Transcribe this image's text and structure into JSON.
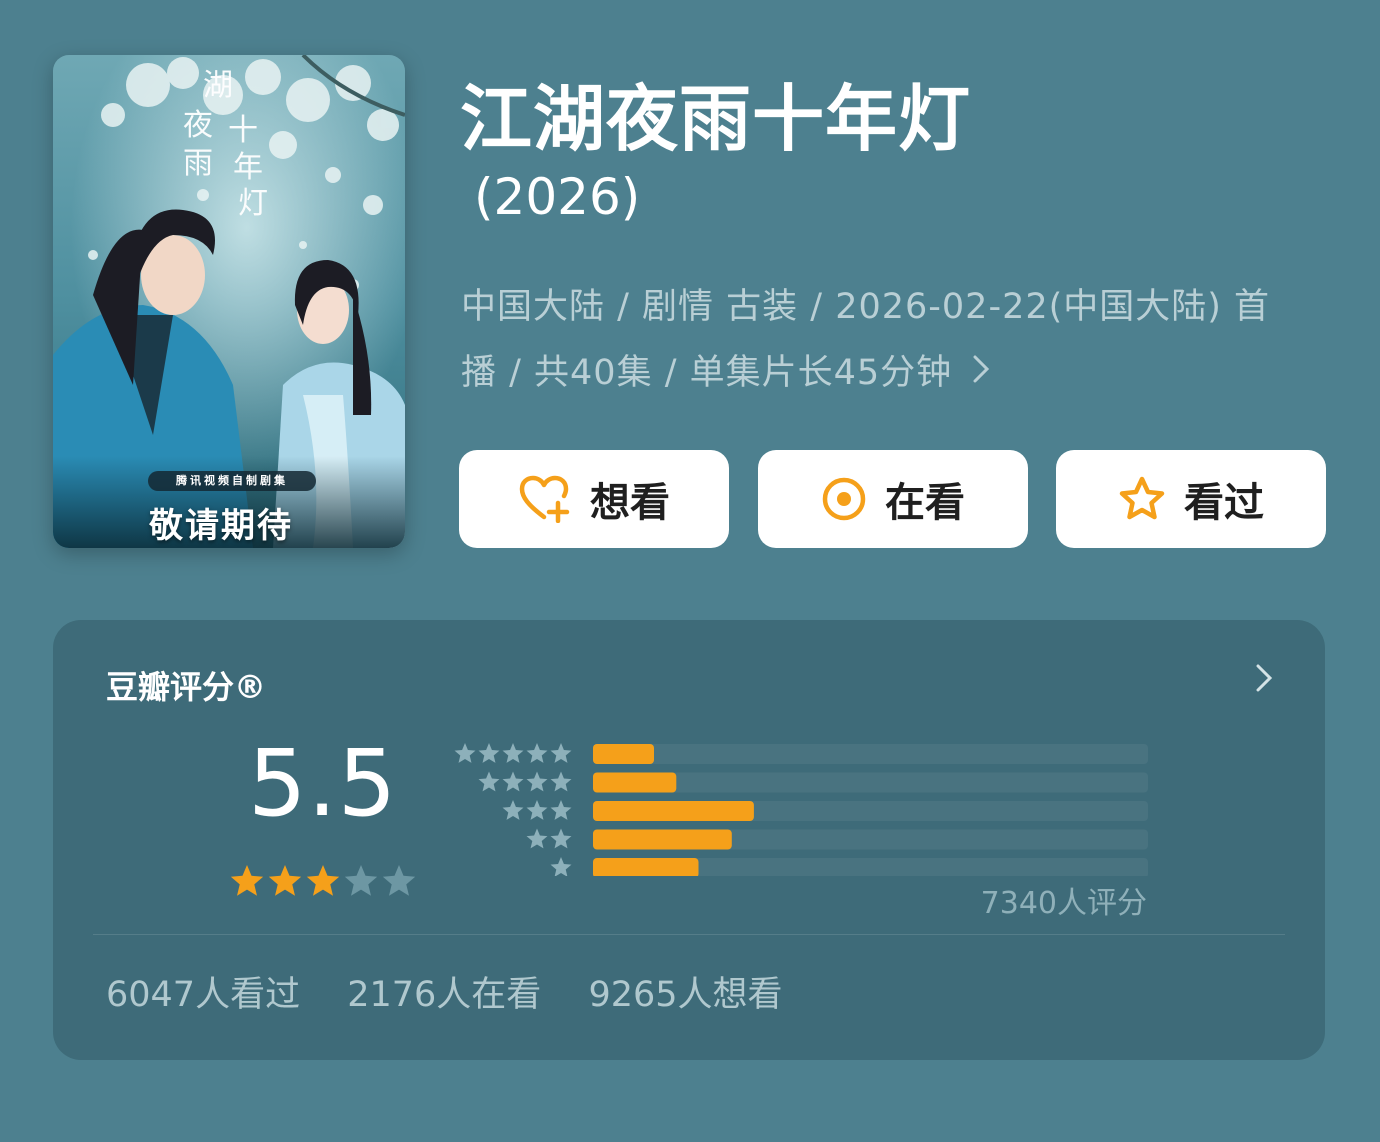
{
  "poster": {
    "calligraphy": "湖夜雨十年灯",
    "tag": "腾讯视频自制剧集",
    "cta": "敬请期待"
  },
  "show": {
    "title": "江湖夜雨十年灯",
    "year": "(2026)",
    "meta_line1": "中国大陆 / 剧情 古装 / 2026-02-22(中国大陆) 首",
    "meta_line2": "播 / 共40集 / 单集片长45分钟"
  },
  "actions": {
    "want": "想看",
    "watching": "在看",
    "watched": "看过"
  },
  "rating": {
    "title": "豆瓣评分®",
    "score": "5.5",
    "stars_filled": 3,
    "stars_total": 5,
    "total_label": "7340人评分",
    "distribution": [
      {
        "stars": 5,
        "fraction": 0.11
      },
      {
        "stars": 4,
        "fraction": 0.15
      },
      {
        "stars": 3,
        "fraction": 0.29
      },
      {
        "stars": 2,
        "fraction": 0.25
      },
      {
        "stars": 1,
        "fraction": 0.19
      }
    ]
  },
  "stats": {
    "watched": "6047人看过",
    "watching": "2176人在看",
    "want": "9265人想看"
  },
  "colors": {
    "background": "#4d808f",
    "card": "#3e6b79",
    "accent": "#f5a01a",
    "star_empty": "#6d97a3",
    "meta_text": "#b9cfd5"
  },
  "icons": [
    "heart-plus-icon",
    "circle-dot-icon",
    "star-outline-icon",
    "chevron-right-icon",
    "star-icon"
  ]
}
